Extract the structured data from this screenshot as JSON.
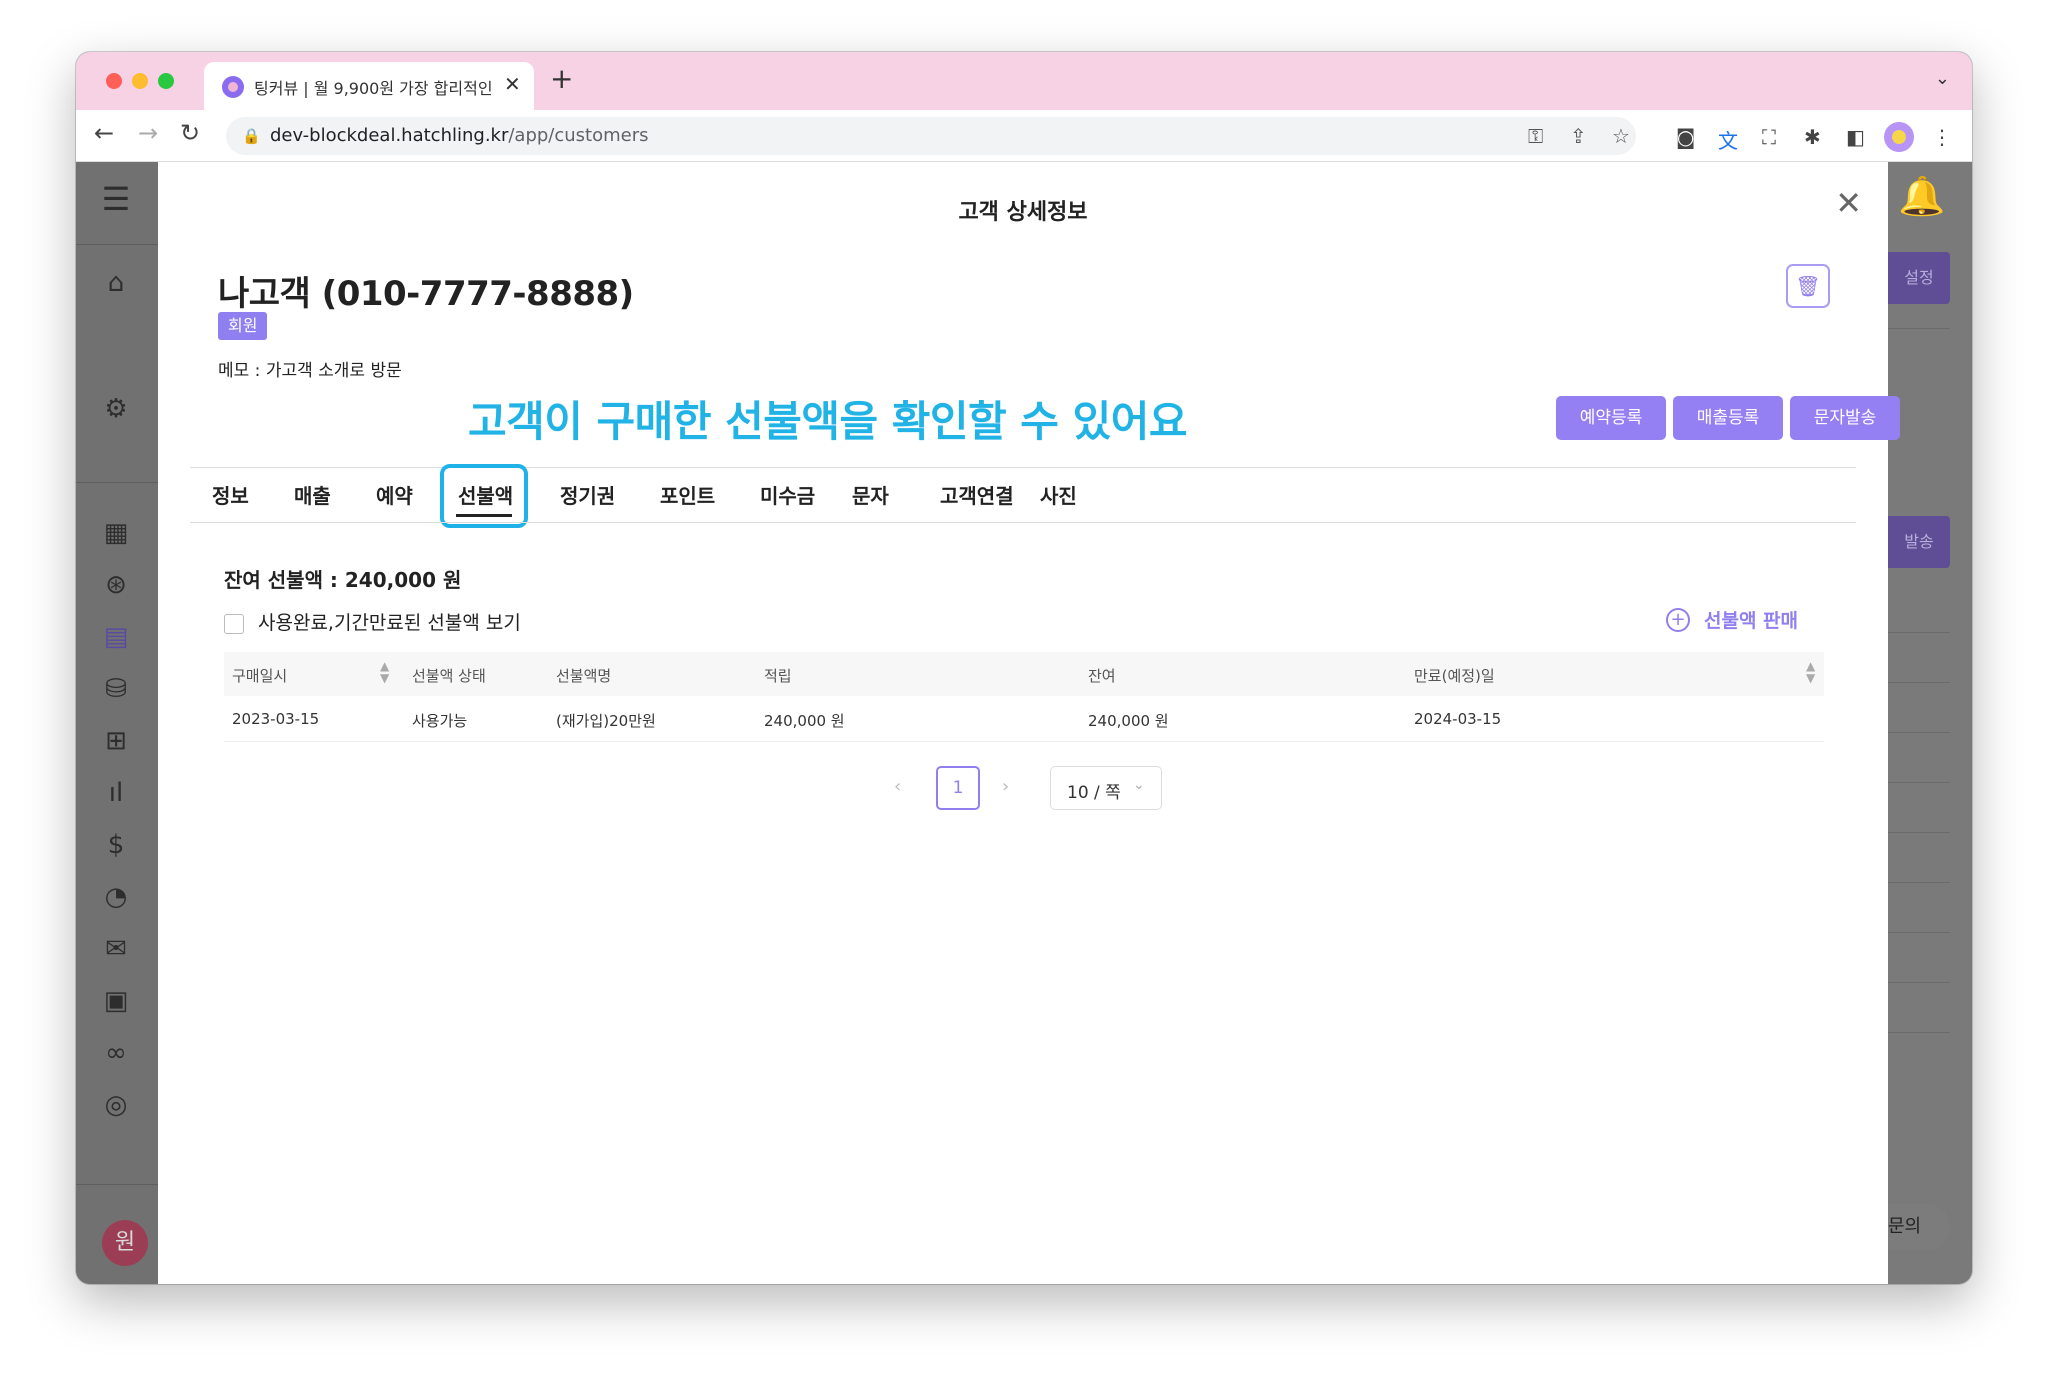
{
  "browser": {
    "tab_title": "팅커뷰 | 월 9,900원 가장 합리적인",
    "tab_close": "✕",
    "new_tab": "+",
    "url_host": "dev-blockdeal.hatchling.kr",
    "url_path": "/app/customers"
  },
  "sidebar": {
    "avatar_text": "원"
  },
  "right_panel": {
    "settings_button": "설정",
    "send_button": "발송",
    "inquiry_label": "문의"
  },
  "modal": {
    "title": "고객 상세정보",
    "customer_name": "나고객 (010-7777-8888)",
    "member_badge": "회원",
    "memo": "메모 : 가고객 소개로 방문",
    "annotation": "고객이 구매한 선불액을 확인할 수 있어요",
    "actions": [
      "예약등록",
      "매출등록",
      "문자발송"
    ],
    "tabs": [
      "정보",
      "매출",
      "예약",
      "선불액",
      "정기권",
      "포인트",
      "미수금",
      "문자",
      "고객연결",
      "사진"
    ],
    "active_tab": "선불액",
    "balance": "잔여 선불액 : 240,000 원",
    "checkbox_label": "사용완료,기간만료된 선불액 보기",
    "sell_link": "선불액 판매",
    "table": {
      "columns": [
        "구매일시",
        "선불액 상태",
        "선불액명",
        "적립",
        "잔여",
        "만료(예정)일"
      ],
      "rows": [
        [
          "2023-03-15",
          "사용가능",
          "(재가입)20만원",
          "240,000 원",
          "240,000 원",
          "2024-03-15"
        ]
      ]
    },
    "pagination": {
      "current_page": "1",
      "page_size": "10 / 쪽"
    }
  },
  "colors": {
    "accent": "#9480f2",
    "annotation": "#22b3e6",
    "tab_bar": "#f6d2e4"
  }
}
